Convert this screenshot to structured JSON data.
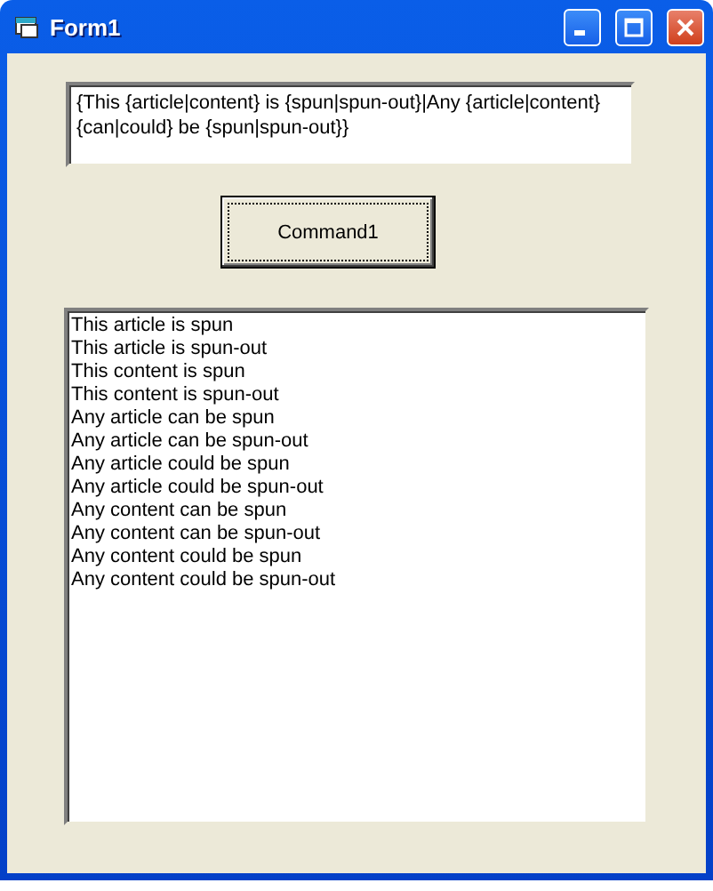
{
  "window": {
    "title": "Form1"
  },
  "text_box": {
    "value": "{This {article|content} is {spun|spun-out}|Any {article|content} {can|could} be {spun|spun-out}}"
  },
  "button": {
    "label": "Command1"
  },
  "list_box": {
    "items": [
      "This article is spun",
      "This article is spun-out",
      "This content is spun",
      "This content is spun-out",
      "Any article can be spun",
      "Any article can be spun-out",
      "Any article could be spun",
      "Any article could be spun-out",
      "Any content can be spun",
      "Any content can be spun-out",
      "Any content could be spun",
      "Any content could be spun-out"
    ]
  }
}
